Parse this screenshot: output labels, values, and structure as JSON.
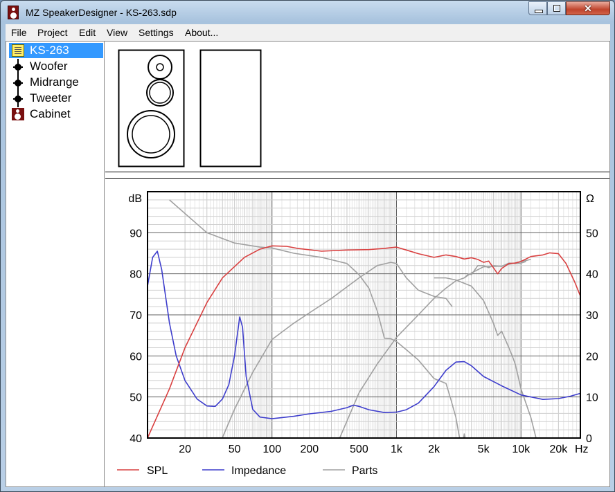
{
  "window": {
    "title": "MZ SpeakerDesigner - KS-263.sdp",
    "close_glyph": "✕"
  },
  "menu": [
    "File",
    "Project",
    "Edit",
    "View",
    "Settings",
    "About..."
  ],
  "tree": [
    {
      "label": "KS-263",
      "icon": "note-icon",
      "selected": true
    },
    {
      "label": "Woofer",
      "icon": "driver-icon"
    },
    {
      "label": "Midrange",
      "icon": "driver-icon"
    },
    {
      "label": "Tweeter",
      "icon": "driver-icon"
    },
    {
      "label": "Cabinet",
      "icon": "cabinet-icon"
    }
  ],
  "chart_data": {
    "type": "line",
    "x_scale": "log",
    "xlim": [
      10,
      30000
    ],
    "ylim_left": [
      40,
      100
    ],
    "ylim_right": [
      0,
      60
    ],
    "left_unit": "dB",
    "right_unit": "Ω",
    "x_unit": "Hz",
    "grid": true,
    "x_ticks": [
      {
        "value": 20,
        "label": "20"
      },
      {
        "value": 50,
        "label": "50"
      },
      {
        "value": 100,
        "label": "100"
      },
      {
        "value": 200,
        "label": "200"
      },
      {
        "value": 500,
        "label": "500"
      },
      {
        "value": 1000,
        "label": "1k"
      },
      {
        "value": 2000,
        "label": "2k"
      },
      {
        "value": 5000,
        "label": "5k"
      },
      {
        "value": 10000,
        "label": "10k"
      },
      {
        "value": 20000,
        "label": "20k"
      }
    ],
    "y_left_ticks": [
      {
        "value": 40,
        "label": "40"
      },
      {
        "value": 50,
        "label": "50"
      },
      {
        "value": 60,
        "label": "60"
      },
      {
        "value": 70,
        "label": "70"
      },
      {
        "value": 80,
        "label": "80"
      },
      {
        "value": 90,
        "label": "90"
      }
    ],
    "y_right_ticks": [
      {
        "value": 0,
        "label": "0"
      },
      {
        "value": 10,
        "label": "10"
      },
      {
        "value": 20,
        "label": "20"
      },
      {
        "value": 30,
        "label": "30"
      },
      {
        "value": 40,
        "label": "40"
      },
      {
        "value": 50,
        "label": "50"
      }
    ],
    "legend_placement": "bottom",
    "series": [
      {
        "name": "SPL",
        "color": "#d94040",
        "axis": "left",
        "points": [
          [
            10,
            40
          ],
          [
            15,
            52
          ],
          [
            20,
            62
          ],
          [
            30,
            73
          ],
          [
            40,
            79
          ],
          [
            60,
            84
          ],
          [
            80,
            86
          ],
          [
            100,
            86.8
          ],
          [
            130,
            86.7
          ],
          [
            160,
            86.2
          ],
          [
            250,
            85.5
          ],
          [
            400,
            85.8
          ],
          [
            600,
            85.9
          ],
          [
            800,
            86.2
          ],
          [
            1000,
            86.5
          ],
          [
            1200,
            85.8
          ],
          [
            1500,
            84.9
          ],
          [
            2000,
            84
          ],
          [
            2500,
            84.6
          ],
          [
            3000,
            84.2
          ],
          [
            3500,
            83.6
          ],
          [
            4000,
            83.9
          ],
          [
            4500,
            83.5
          ],
          [
            5000,
            82.8
          ],
          [
            5500,
            83.1
          ],
          [
            6000,
            81.5
          ],
          [
            6500,
            80
          ],
          [
            7000,
            81.3
          ],
          [
            8000,
            82.5
          ],
          [
            9000,
            82.6
          ],
          [
            10000,
            83
          ],
          [
            12000,
            84.2
          ],
          [
            15000,
            84.6
          ],
          [
            17000,
            85.1
          ],
          [
            20000,
            84.9
          ],
          [
            23000,
            82.5
          ],
          [
            27000,
            78
          ],
          [
            31000,
            73.5
          ]
        ]
      },
      {
        "name": "Impedance",
        "color": "#3d3dcc",
        "axis": "right",
        "points": [
          [
            10,
            37
          ],
          [
            11,
            44
          ],
          [
            12,
            45.5
          ],
          [
            13,
            41
          ],
          [
            15,
            28
          ],
          [
            17,
            20
          ],
          [
            20,
            14
          ],
          [
            25,
            9.5
          ],
          [
            30,
            7.8
          ],
          [
            35,
            7.7
          ],
          [
            40,
            9.5
          ],
          [
            45,
            13
          ],
          [
            50,
            20
          ],
          [
            55,
            29.5
          ],
          [
            58,
            27
          ],
          [
            62,
            15
          ],
          [
            70,
            7
          ],
          [
            80,
            5.1
          ],
          [
            100,
            4.7
          ],
          [
            150,
            5.3
          ],
          [
            200,
            5.9
          ],
          [
            300,
            6.5
          ],
          [
            400,
            7.4
          ],
          [
            450,
            8
          ],
          [
            500,
            7.7
          ],
          [
            600,
            6.9
          ],
          [
            800,
            6.2
          ],
          [
            1000,
            6.3
          ],
          [
            1200,
            6.9
          ],
          [
            1500,
            8.5
          ],
          [
            2000,
            12.5
          ],
          [
            2500,
            16.5
          ],
          [
            3000,
            18.5
          ],
          [
            3500,
            18.6
          ],
          [
            4000,
            17.6
          ],
          [
            5000,
            15
          ],
          [
            7000,
            12.7
          ],
          [
            10000,
            10.5
          ],
          [
            15000,
            9.4
          ],
          [
            20000,
            9.6
          ],
          [
            25000,
            10.2
          ],
          [
            31000,
            11
          ]
        ]
      },
      {
        "name": "Parts",
        "color": "#a0a0a0",
        "axis": "left",
        "segments": [
          [
            [
              35,
              36
            ],
            [
              50,
              47
            ],
            [
              70,
              56
            ],
            [
              100,
              64
            ],
            [
              150,
              68
            ],
            [
              200,
              70.5
            ],
            [
              300,
              74
            ],
            [
              500,
              79
            ],
            [
              700,
              82
            ],
            [
              900,
              82.8
            ],
            [
              1000,
              82.5
            ],
            [
              1200,
              79
            ],
            [
              1500,
              76
            ],
            [
              2000,
              74.5
            ],
            [
              2500,
              74
            ],
            [
              2800,
              72
            ]
          ],
          [
            [
              15,
              98
            ],
            [
              30,
              90
            ],
            [
              50,
              87.5
            ],
            [
              80,
              86.5
            ],
            [
              100,
              86.3
            ],
            [
              150,
              85
            ],
            [
              250,
              84
            ],
            [
              400,
              82.5
            ],
            [
              500,
              79.8
            ],
            [
              600,
              76.5
            ],
            [
              700,
              71
            ],
            [
              800,
              64.3
            ],
            [
              900,
              64.2
            ],
            [
              1000,
              63.5
            ],
            [
              1200,
              61.5
            ],
            [
              1500,
              59
            ],
            [
              2000,
              54.5
            ],
            [
              2500,
              53.3
            ],
            [
              2700,
              50
            ],
            [
              3000,
              45
            ],
            [
              3300,
              38
            ]
          ],
          [
            [
              3400,
              38
            ],
            [
              3500,
              41
            ],
            [
              3600,
              39
            ]
          ],
          [
            [
              250,
              28
            ],
            [
              350,
              40
            ],
            [
              500,
              51
            ],
            [
              700,
              58
            ],
            [
              1000,
              64.5
            ],
            [
              1500,
              70
            ],
            [
              2000,
              74
            ],
            [
              2500,
              76.5
            ],
            [
              3000,
              78.3
            ],
            [
              3500,
              79
            ],
            [
              4000,
              80.2
            ],
            [
              5000,
              81.7
            ],
            [
              6000,
              81.8
            ],
            [
              7000,
              81.9
            ],
            [
              8000,
              82.3
            ],
            [
              10000,
              83
            ],
            [
              12000,
              83.5
            ]
          ],
          [
            [
              2000,
              79
            ],
            [
              2500,
              79
            ],
            [
              3000,
              78.5
            ],
            [
              4000,
              77
            ],
            [
              5000,
              73.5
            ],
            [
              6000,
              68
            ],
            [
              6500,
              65
            ],
            [
              7000,
              66
            ],
            [
              8000,
              62
            ],
            [
              8500,
              60
            ],
            [
              9000,
              58
            ],
            [
              10000,
              52
            ],
            [
              12000,
              45
            ],
            [
              14000,
              37
            ],
            [
              16000,
              30
            ]
          ],
          [
            [
              3500,
              79
            ],
            [
              3800,
              80
            ],
            [
              4000,
              79.8
            ],
            [
              4500,
              82
            ],
            [
              5000,
              82
            ],
            [
              5500,
              81.5
            ],
            [
              6000,
              82
            ],
            [
              7000,
              81.8
            ],
            [
              8000,
              82.6
            ],
            [
              9000,
              82.5
            ],
            [
              10000,
              82.6
            ],
            [
              11000,
              83
            ]
          ]
        ]
      }
    ]
  }
}
